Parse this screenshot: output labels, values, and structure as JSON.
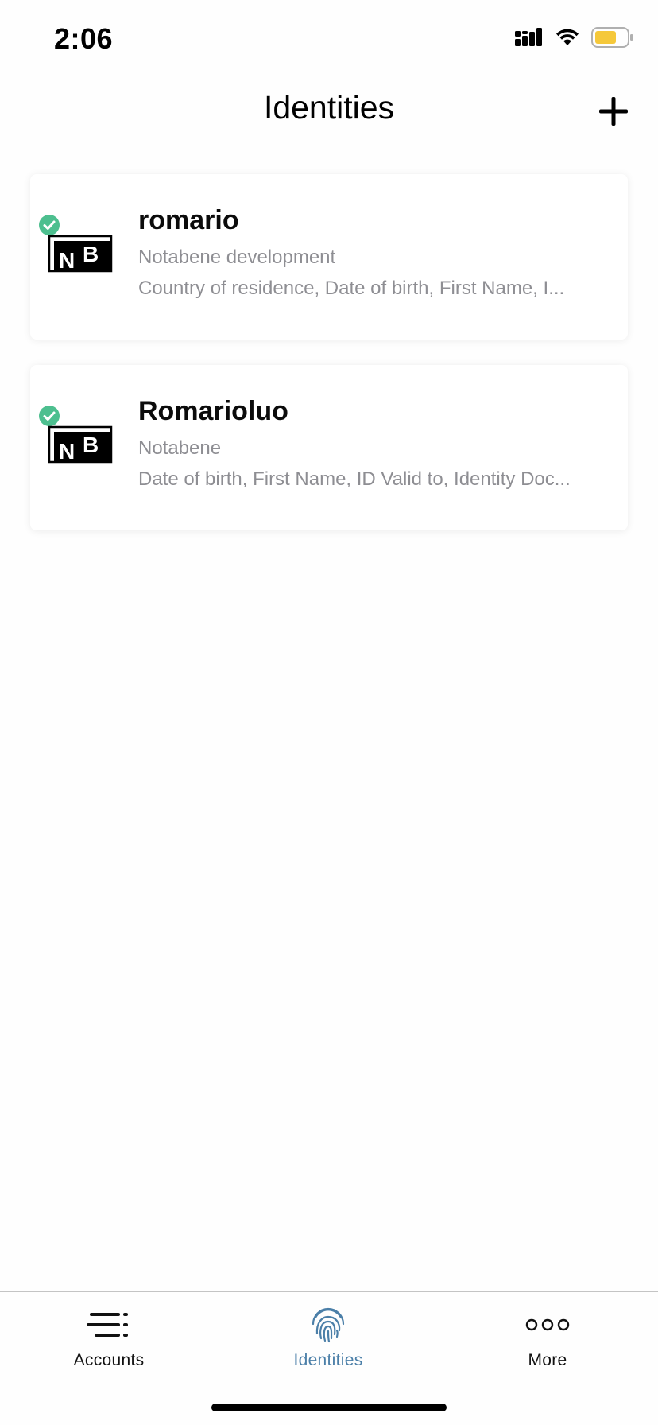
{
  "status_bar": {
    "time": "2:06",
    "battery_color": "#f5c83a"
  },
  "header": {
    "title": "Identities",
    "add_icon": "plus-icon"
  },
  "identities": [
    {
      "name": "romario",
      "organization": "Notabene development",
      "fields": "Country of residence, Date of birth, First Name, I...",
      "verified": true,
      "logo": "NB"
    },
    {
      "name": "Romarioluo",
      "organization": "Notabene",
      "fields": "Date of birth, First Name, ID Valid to, Identity Doc...",
      "verified": true,
      "logo": "NB"
    }
  ],
  "tab_bar": {
    "tabs": [
      {
        "label": "Accounts",
        "icon": "list-icon",
        "active": false
      },
      {
        "label": "Identities",
        "icon": "fingerprint-icon",
        "active": true
      },
      {
        "label": "More",
        "icon": "more-dots-icon",
        "active": false
      }
    ]
  },
  "colors": {
    "accent": "#4b7fa8",
    "verified": "#4dbf8f",
    "secondary_text": "#8e8e93"
  }
}
